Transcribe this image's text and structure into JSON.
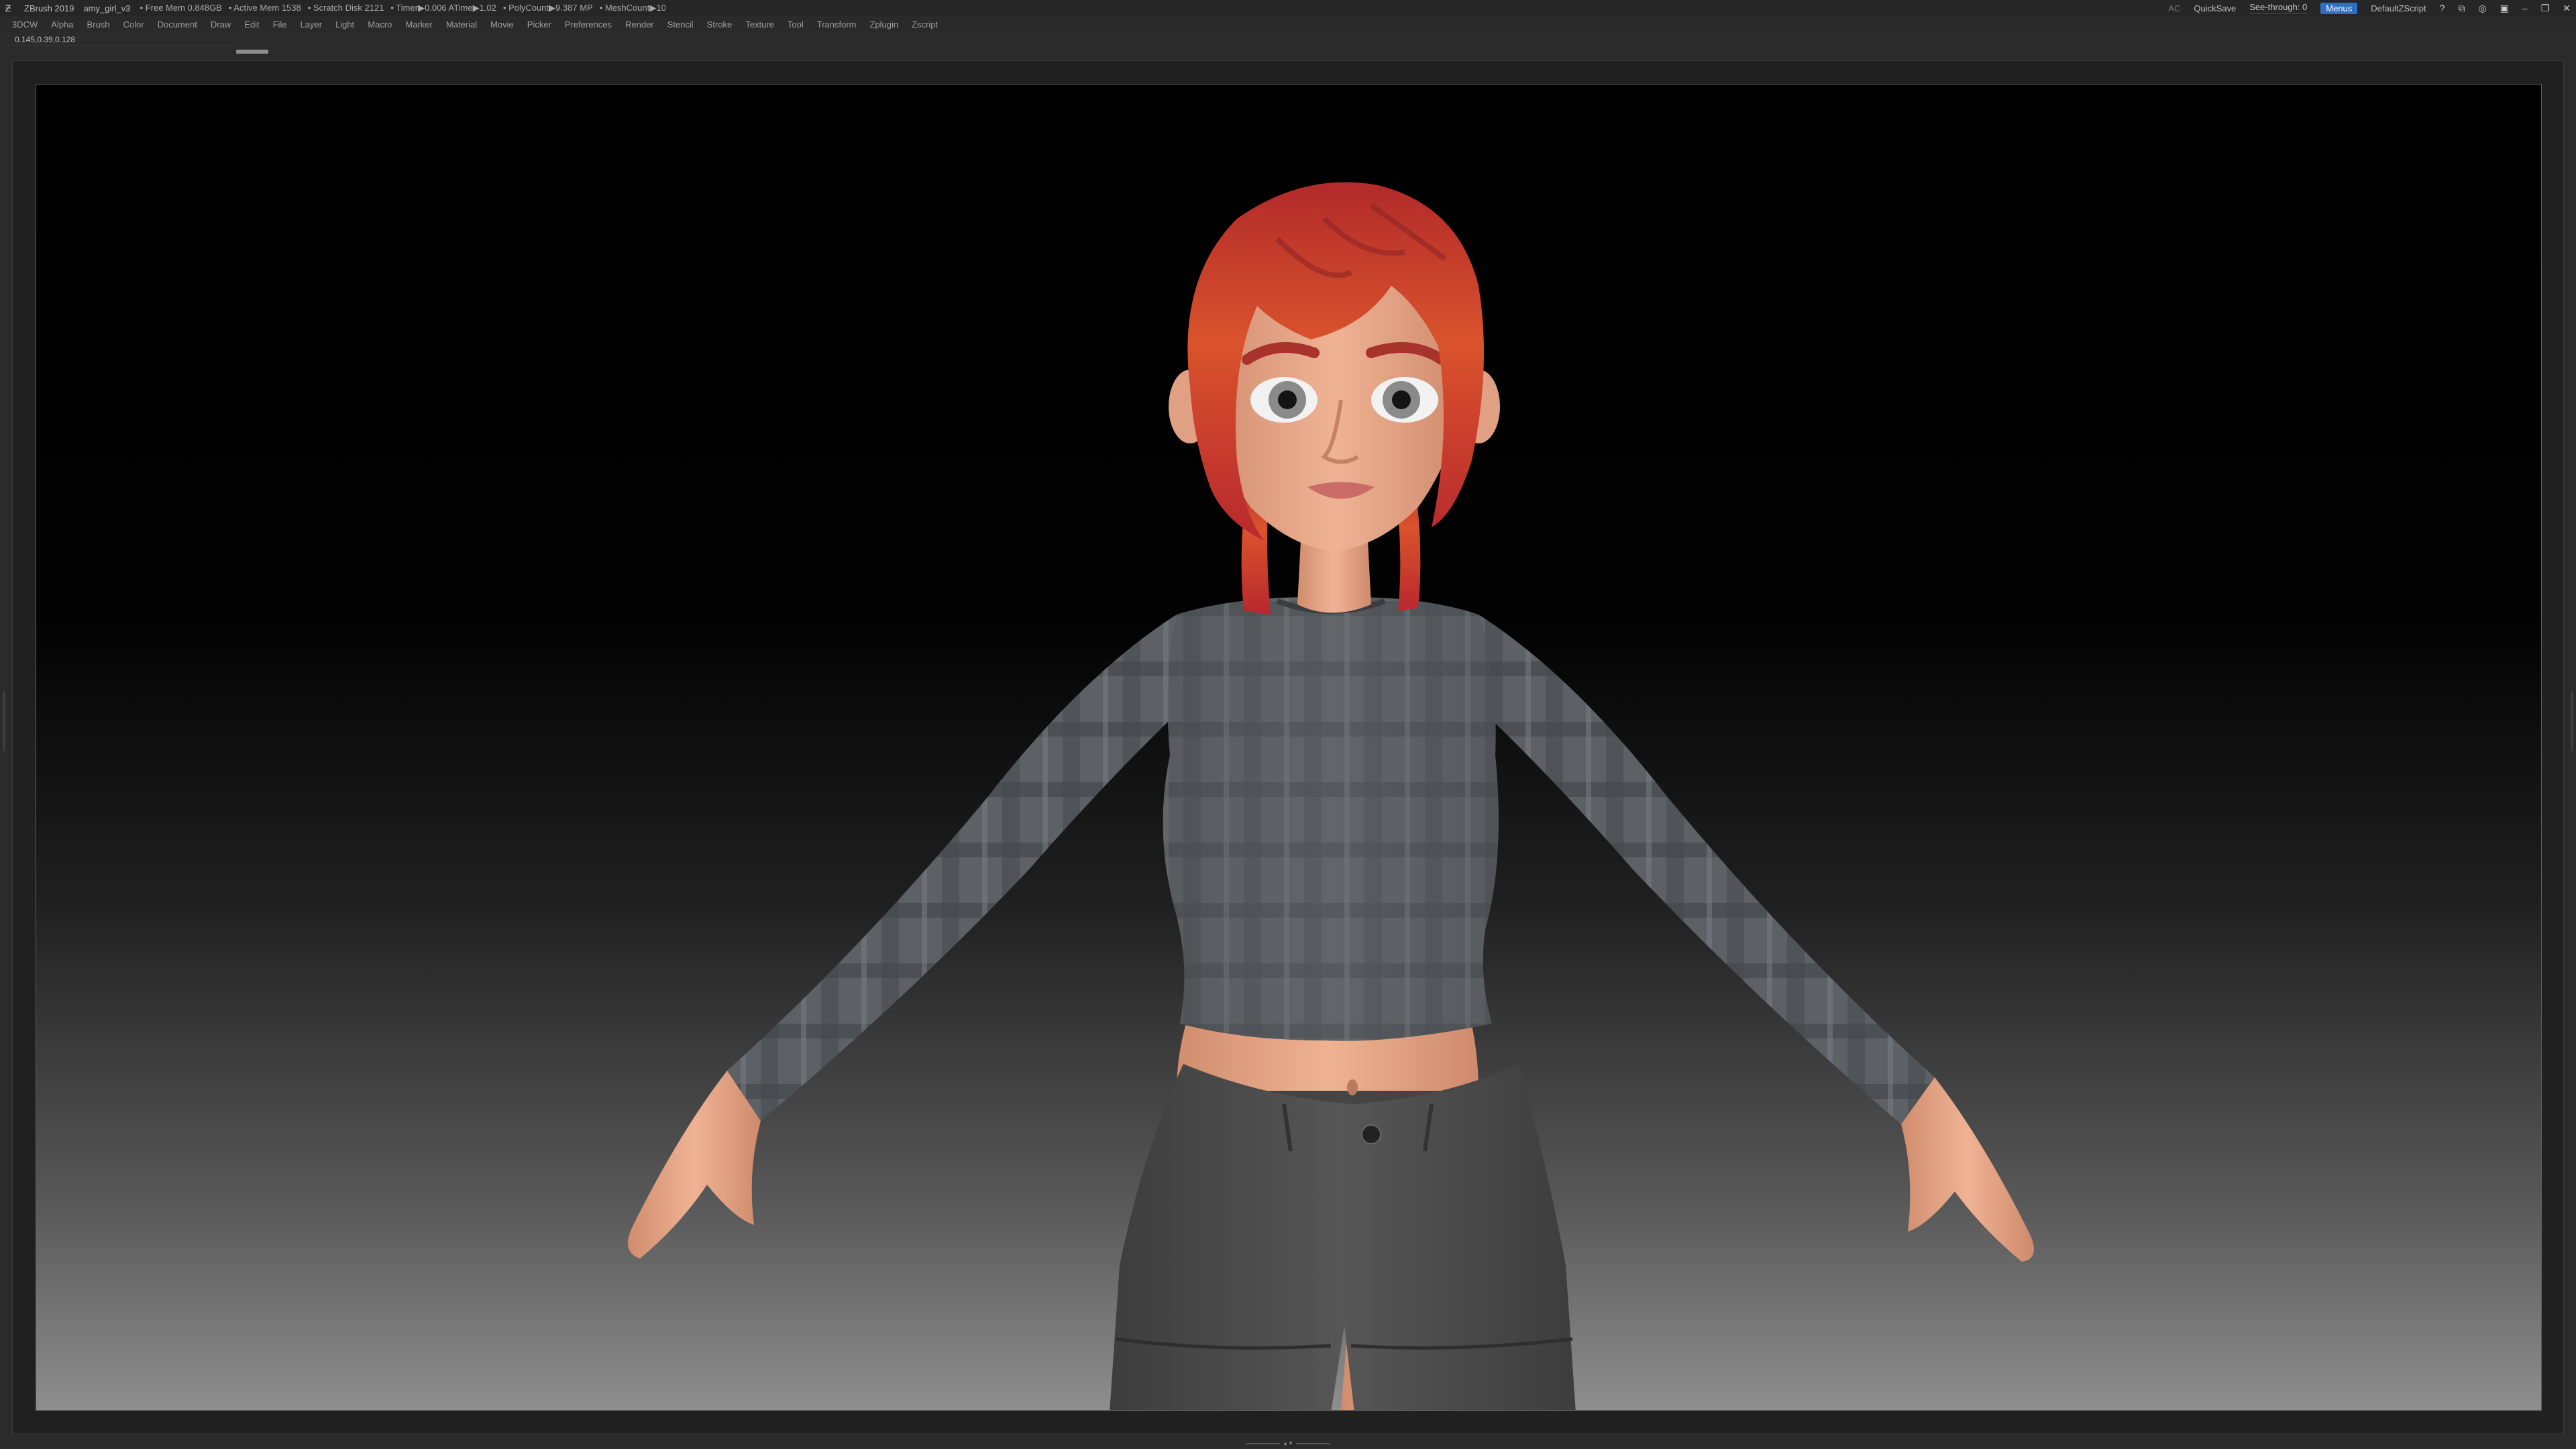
{
  "titlebar": {
    "app_title": "ZBrush 2019",
    "document_name": "amy_girl_v3",
    "stats": [
      "• Free Mem 0.848GB",
      "• Active Mem 1538",
      "• Scratch Disk 2121",
      "• Timer▶0.006 ATime▶1.02",
      "• PolyCount▶9.387 MP",
      "• MeshCount▶10"
    ],
    "ac_label": "AC",
    "quicksave_label": "QuickSave",
    "seethrough_label": "See-through",
    "seethrough_value": "0",
    "menus_label": "Menus",
    "default_script_label": "DefaultZScript",
    "icons": [
      "help-icon",
      "layout-icon",
      "palette-icon",
      "lock-icon",
      "minimize-icon",
      "restore-icon",
      "close-icon"
    ]
  },
  "menubar": {
    "items": [
      "3DCW",
      "Alpha",
      "Brush",
      "Color",
      "Document",
      "Draw",
      "Edit",
      "File",
      "Layer",
      "Light",
      "Macro",
      "Marker",
      "Material",
      "Movie",
      "Picker",
      "Preferences",
      "Render",
      "Stencil",
      "Stroke",
      "Texture",
      "Tool",
      "Transform",
      "Zplugin",
      "Zscript"
    ]
  },
  "infobar": {
    "coords": "0.145,0.39,0.128"
  },
  "viewport": {
    "subject": "character-model"
  },
  "colors": {
    "accent": "#2d6fc4",
    "seethrough_slider": "#e08a1e",
    "hair": "#c23a2a",
    "skin": "#e8a88a",
    "shirt": "#5e6266",
    "shorts": "#4a4a4a"
  }
}
